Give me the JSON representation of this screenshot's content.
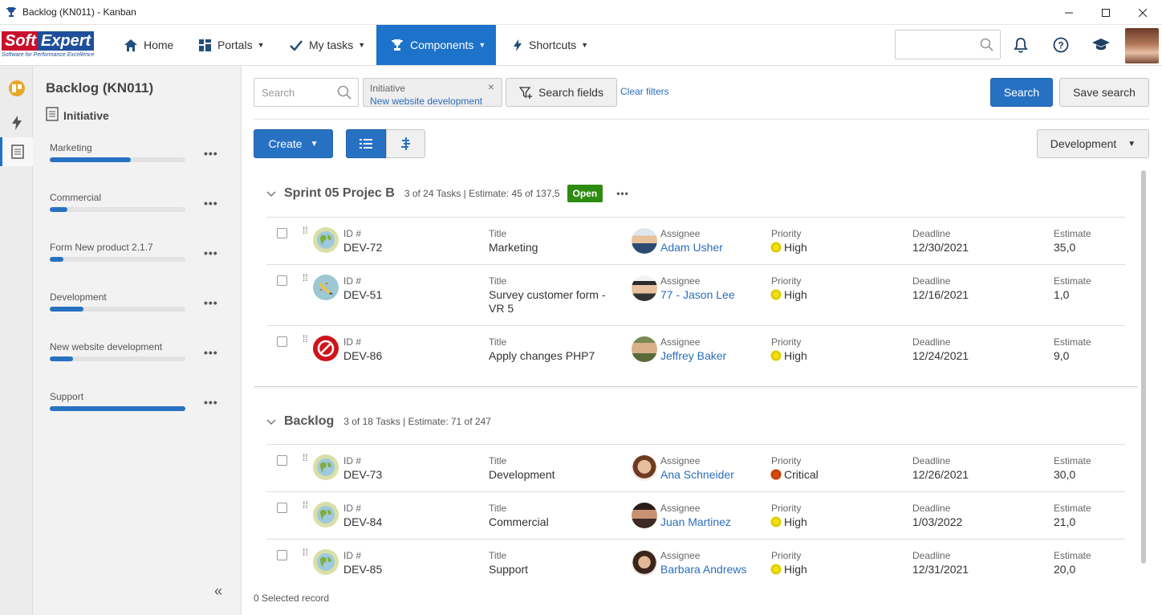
{
  "window": {
    "title": "Backlog (KN011) - Kanban",
    "minimize_icon": "minimize-icon",
    "maximize_icon": "maximize-icon",
    "close_icon": "close-icon"
  },
  "logo": {
    "soft": "Soft",
    "expert": "Expert",
    "tagline": "Software for Performance Excellence"
  },
  "nav": {
    "items": [
      {
        "label": "Home",
        "icon": "home-icon",
        "active": false
      },
      {
        "label": "Portals",
        "icon": "grid-icon",
        "active": false
      },
      {
        "label": "My tasks",
        "icon": "check-icon",
        "active": false
      },
      {
        "label": "Components",
        "icon": "trophy-icon",
        "active": true
      },
      {
        "label": "Shortcuts",
        "icon": "bolt-icon",
        "active": false
      }
    ],
    "right_icons": [
      "bell-icon",
      "help-icon",
      "graduation-cap-icon"
    ]
  },
  "left_panel": {
    "title": "Backlog (KN011)",
    "subtitle": "Initiative",
    "items": [
      {
        "name": "Marketing",
        "progress": 0.6
      },
      {
        "name": "Commercial",
        "progress": 0.13
      },
      {
        "name": "Form New product 2.1.7",
        "progress": 0.1
      },
      {
        "name": "Development",
        "progress": 0.25
      },
      {
        "name": "New website development",
        "progress": 0.17
      },
      {
        "name": "Support",
        "progress": 1.0
      }
    ],
    "more_label": "•••",
    "collapse_label": "«"
  },
  "toolbar": {
    "search_placeholder": "Search",
    "filter_label": "Initiative",
    "filter_value": "New website development",
    "filter_remove": "×",
    "search_fields": "Search fields",
    "clear_filters": "Clear filters",
    "search": "Search",
    "save_search": "Save search",
    "create": "Create",
    "view_dropdown": "Development"
  },
  "labels": {
    "id": "ID #",
    "title": "Title",
    "assignee": "Assignee",
    "priority": "Priority",
    "deadline": "Deadline",
    "estimate": "Estimate"
  },
  "groups": [
    {
      "name": "Sprint 05 Projec B",
      "info": "3 of 24 Tasks | Estimate: 45 of 137,5",
      "badge": "Open",
      "more": "•••",
      "tasks": [
        {
          "id": "DEV-72",
          "title": "Marketing",
          "assignee": "Adam Usher",
          "priority": "High",
          "priority_level": "high",
          "deadline": "12/30/2021",
          "estimate": "35,0",
          "type_icon": "globe-icon"
        },
        {
          "id": "DEV-51",
          "title": "Survey customer form - VR 5",
          "assignee": "77 - Jason Lee",
          "priority": "High",
          "priority_level": "high",
          "deadline": "12/16/2021",
          "estimate": "1,0",
          "type_icon": "pencil-icon"
        },
        {
          "id": "DEV-86",
          "title": "Apply changes PHP7",
          "assignee": "Jeffrey Baker",
          "priority": "High",
          "priority_level": "high",
          "deadline": "12/24/2021",
          "estimate": "9,0",
          "type_icon": "blocked-icon"
        }
      ]
    },
    {
      "name": "Backlog",
      "info": "3 of 18 Tasks | Estimate: 71 of 247",
      "tasks": [
        {
          "id": "DEV-73",
          "title": "Development",
          "assignee": "Ana Schneider",
          "priority": "Critical",
          "priority_level": "critical",
          "deadline": "12/26/2021",
          "estimate": "30,0",
          "type_icon": "globe-icon"
        },
        {
          "id": "DEV-84",
          "title": "Commercial",
          "assignee": "Juan Martinez",
          "priority": "High",
          "priority_level": "high",
          "deadline": "1/03/2022",
          "estimate": "21,0",
          "type_icon": "globe-icon"
        },
        {
          "id": "DEV-85",
          "title": "Support",
          "assignee": "Barbara Andrews",
          "priority": "High",
          "priority_level": "high",
          "deadline": "12/31/2021",
          "estimate": "20,0",
          "type_icon": "globe-icon"
        }
      ]
    }
  ],
  "footer": {
    "selected": "0 Selected record"
  },
  "colors": {
    "accent": "#1d72c9",
    "open_badge": "#2e8b12",
    "progress": "#2771c2"
  }
}
